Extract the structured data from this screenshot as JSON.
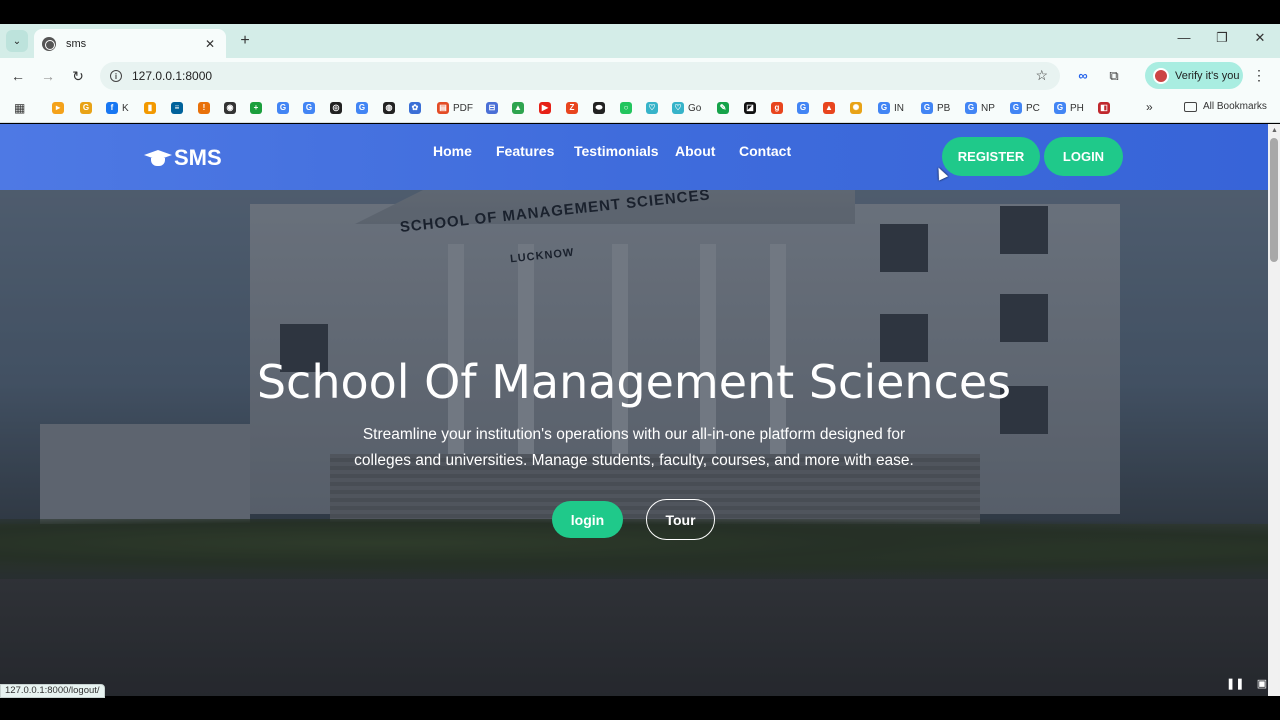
{
  "browser": {
    "tab": {
      "title": "sms",
      "close": "✕"
    },
    "new_tab": "+",
    "url": "127.0.0.1:8000",
    "verify_label": "Verify it's you",
    "window_controls": {
      "minimize": "—",
      "restore": "❐",
      "close": "✕"
    }
  },
  "bookmarks": {
    "items": [
      {
        "label": "",
        "color": "#f4a21b",
        "glyph": "▸"
      },
      {
        "label": "",
        "color": "#e8a317",
        "glyph": "G"
      },
      {
        "label": "K",
        "color": "#1877f2",
        "glyph": "f"
      },
      {
        "label": "",
        "color": "#f29900",
        "glyph": "▮"
      },
      {
        "label": "",
        "color": "#00629b",
        "glyph": "≡"
      },
      {
        "label": "",
        "color": "#e8710a",
        "glyph": "!"
      },
      {
        "label": "",
        "color": "#333333",
        "glyph": "◉"
      },
      {
        "label": "",
        "color": "#1a9f3c",
        "glyph": "+"
      },
      {
        "label": "",
        "color": "#4285f4",
        "glyph": "G"
      },
      {
        "label": "",
        "color": "#4285f4",
        "glyph": "G"
      },
      {
        "label": "",
        "color": "#222222",
        "glyph": "◎"
      },
      {
        "label": "",
        "color": "#4285f4",
        "glyph": "G"
      },
      {
        "label": "",
        "color": "#222222",
        "glyph": "◍"
      },
      {
        "label": "",
        "color": "#3b6fd6",
        "glyph": "✿"
      },
      {
        "label": "PDF",
        "color": "#e34c26",
        "glyph": "▤"
      },
      {
        "label": "",
        "color": "#4a6fd6",
        "glyph": "⊟"
      },
      {
        "label": "",
        "color": "#2ea44f",
        "glyph": "▲"
      },
      {
        "label": "",
        "color": "#e62117",
        "glyph": "▶"
      },
      {
        "label": "",
        "color": "#e8451e",
        "glyph": "Z"
      },
      {
        "label": "",
        "color": "#222222",
        "glyph": "⬬"
      },
      {
        "label": "",
        "color": "#22c55e",
        "glyph": "○"
      },
      {
        "label": "",
        "color": "#36b3c9",
        "glyph": "♡"
      },
      {
        "label": "Go",
        "color": "#36b3c9",
        "glyph": "♡"
      },
      {
        "label": "",
        "color": "#16a34a",
        "glyph": "✎"
      },
      {
        "label": "",
        "color": "#111111",
        "glyph": "◪"
      },
      {
        "label": "",
        "color": "#e8451e",
        "glyph": "g"
      },
      {
        "label": "",
        "color": "#4285f4",
        "glyph": "G"
      },
      {
        "label": "",
        "color": "#e8451e",
        "glyph": "▲"
      },
      {
        "label": "",
        "color": "#e8a317",
        "glyph": "✺"
      },
      {
        "label": "IN",
        "color": "#4285f4",
        "glyph": "G"
      },
      {
        "label": "PB",
        "color": "#4285f4",
        "glyph": "G"
      },
      {
        "label": "NP",
        "color": "#4285f4",
        "glyph": "G"
      },
      {
        "label": "PC",
        "color": "#4285f4",
        "glyph": "G"
      },
      {
        "label": "PH",
        "color": "#4285f4",
        "glyph": "G"
      },
      {
        "label": "",
        "color": "#c0282d",
        "glyph": "◧"
      }
    ],
    "more": "»",
    "all_bookmarks": "All Bookmarks"
  },
  "site": {
    "logo": "SMS",
    "nav": [
      "Home",
      "Features",
      "Testimonials",
      "About",
      "Contact"
    ],
    "register": "REGISTER",
    "login": "LOGIN",
    "sign_line1": "SCHOOL OF MANAGEMENT SCIENCES",
    "sign_line2": "LUCKNOW",
    "hero_title": "School Of Management Sciences",
    "hero_subtitle": "Streamline your institution's operations with our all-in-one platform designed for colleges and universities. Manage students, faculty, courses, and more with ease.",
    "cta_login": "login",
    "cta_tour": "Tour",
    "accent_color": "#1fc98a",
    "nav_color": "#4574e0"
  },
  "status_url": "127.0.0.1:8000/logout/"
}
